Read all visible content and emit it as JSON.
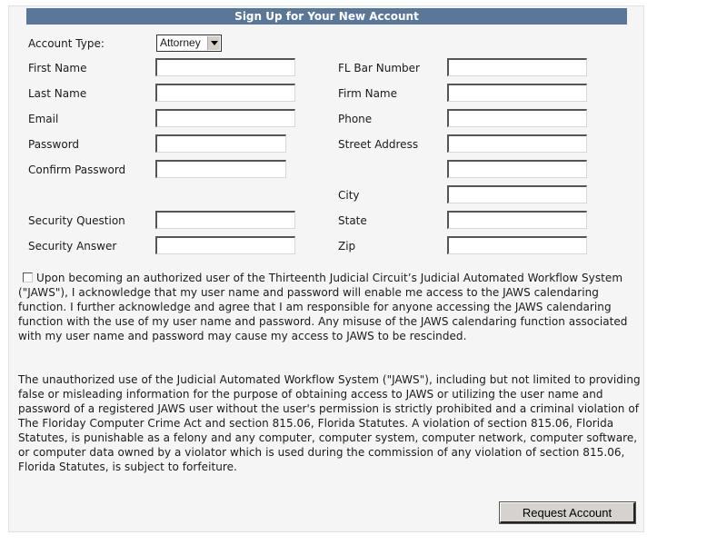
{
  "form": {
    "title": "Sign Up for Your New Account",
    "account_type": {
      "label": "Account Type:",
      "selected": "Attorney"
    },
    "left_fields": [
      {
        "label": "First Name",
        "value": ""
      },
      {
        "label": "Last Name",
        "value": ""
      },
      {
        "label": "Email",
        "value": ""
      },
      {
        "label": "Password",
        "value": ""
      },
      {
        "label": "Confirm Password",
        "value": ""
      },
      {
        "label": "Security Question",
        "value": ""
      },
      {
        "label": "Security Answer",
        "value": ""
      }
    ],
    "right_fields": [
      {
        "label": "FL Bar Number",
        "value": ""
      },
      {
        "label": "Firm Name",
        "value": ""
      },
      {
        "label": "Phone",
        "value": ""
      },
      {
        "label": "Street Address",
        "value": ""
      },
      {
        "label": "",
        "value": ""
      },
      {
        "label": "City",
        "value": ""
      },
      {
        "label": "State",
        "value": ""
      },
      {
        "label": "Zip",
        "value": ""
      }
    ],
    "agreement": {
      "checked": false,
      "text": "Upon becoming an authorized user of the Thirteenth Judicial Circuit’s Judicial Automated Workflow System (\"JAWS\"), I acknowledge that my user name and password will enable me access to the JAWS calendaring function. I further acknowledge and agree that I am responsible for anyone accessing the JAWS calendaring function with the use of my user name and password. Any misuse of the JAWS calendaring function associated with my user name and password may cause my access to JAWS to be rescinded."
    },
    "warning_text": "The unauthorized use of the Judicial Automated Workflow System (\"JAWS\"), including but not limited to providing false or misleading information for the purpose of obtaining access to JAWS or utilizing the user name and password of a registered JAWS user without the user's permission is strictly prohibited and a criminal violation of The Floriday Computer Crime Act and section 815.06, Florida Statutes. A violation of section 815.06, Florida Statutes, is punishable as a felony and any computer, computer system, computer network, computer software, or computer data owned by a violator which is used during the commission of any violation of section 815.06, Florida Statutes, is subject to forfeiture.",
    "submit_label": "Request Account",
    "colors": {
      "title_bar": "#5a7698",
      "panel_bg": "#f5f5f5",
      "button_bg": "#d6d3ce"
    }
  }
}
